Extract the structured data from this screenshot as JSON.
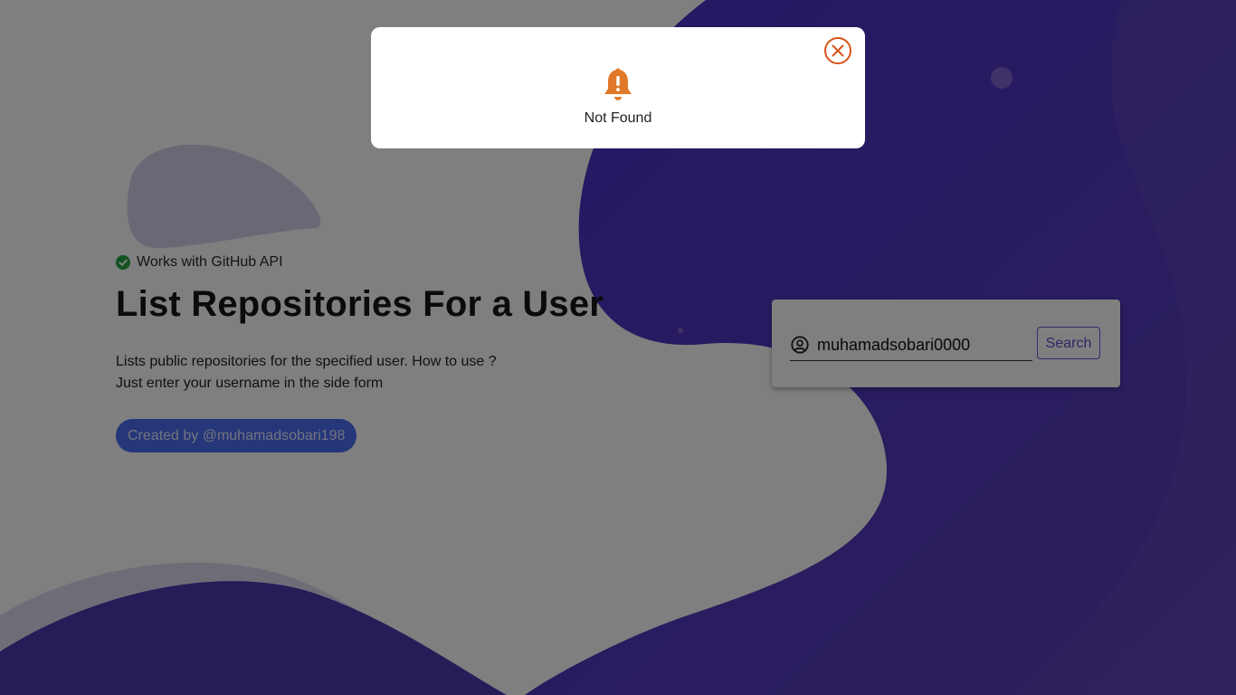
{
  "colors": {
    "accent_purple": "#4a3aa8",
    "creator_button": "#4a6cf3",
    "alert_orange": "#e07a2a",
    "success_green": "#28a745"
  },
  "hero": {
    "badge_text": "Works with GitHub API",
    "badge_icon": "check-circle-icon",
    "title": "List Repositories For a User",
    "description_line1": "Lists public repositories for the specified user. How to use ?",
    "description_line2": "Just enter your username in the side form",
    "creator_label": "Created by @muhamadsobari198"
  },
  "search": {
    "user_icon": "user-circle-icon",
    "value": "muhamadsobari0000",
    "button_label": "Search"
  },
  "modal": {
    "icon": "bell-alert-icon",
    "close_icon": "close-circle-icon",
    "message": "Not Found"
  }
}
